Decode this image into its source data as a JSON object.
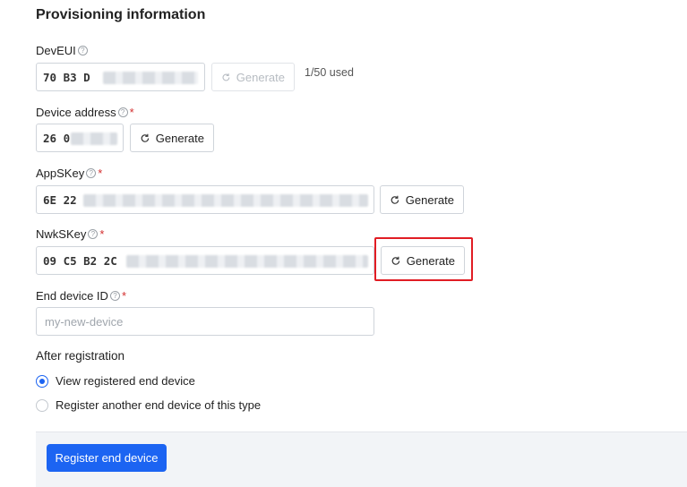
{
  "section_title": "Provisioning information",
  "devEUI": {
    "label": "DevEUI",
    "value": "70 B3 D",
    "generate_label": "Generate",
    "used": "1/50 used"
  },
  "device_address": {
    "label": "Device address",
    "value": "26 0",
    "generate_label": "Generate"
  },
  "appSKey": {
    "label": "AppSKey",
    "value": "6E 22",
    "generate_label": "Generate"
  },
  "nwkSKey": {
    "label": "NwkSKey",
    "value": "09 C5 B2 2C",
    "generate_label": "Generate"
  },
  "end_device_id": {
    "label": "End device ID",
    "placeholder": "my-new-device"
  },
  "after_registration": {
    "title": "After registration",
    "options": [
      "View registered end device",
      "Register another end device of this type"
    ],
    "selected": 0
  },
  "footer": {
    "register_label": "Register end device"
  },
  "colors": {
    "accent": "#1c64f2",
    "required": "#d32f2f",
    "highlight": "#e11d24"
  },
  "icons": {
    "help": "question-circle-icon",
    "generate": "refresh-icon"
  }
}
